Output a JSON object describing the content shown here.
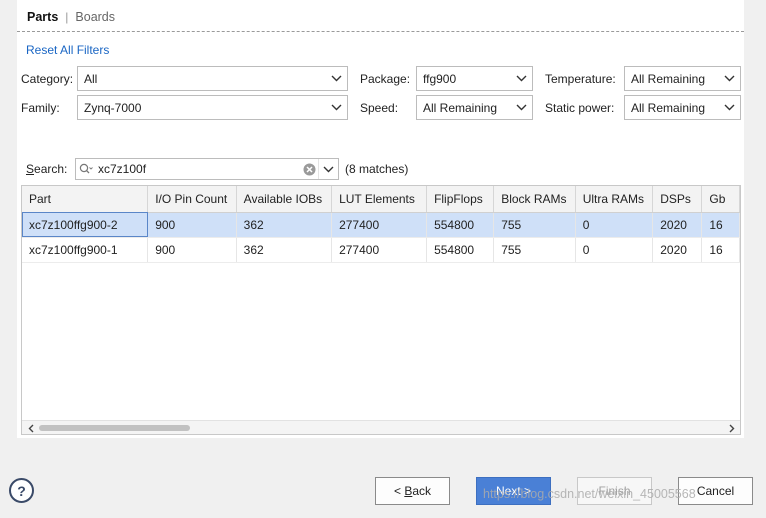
{
  "tabs": [
    {
      "label": "Parts"
    },
    {
      "label": "Boards"
    }
  ],
  "reset_filters": "Reset All Filters",
  "filters": {
    "category": {
      "label": "Category:",
      "value": "All"
    },
    "family": {
      "label": "Family:",
      "value": "Zynq-7000"
    },
    "package": {
      "label": "Package:",
      "value": "ffg900"
    },
    "speed": {
      "label": "Speed:",
      "value": "All Remaining"
    },
    "temperature": {
      "label": "Temperature:",
      "value": "All Remaining"
    },
    "static_power": {
      "label": "Static power:",
      "value": "All Remaining"
    }
  },
  "search": {
    "label_prefix": "S",
    "label_rest": "earch:",
    "value": "xc7z100f",
    "matches": "(8 matches)"
  },
  "table": {
    "columns": [
      "Part",
      "I/O Pin Count",
      "Available IOBs",
      "LUT Elements",
      "FlipFlops",
      "Block RAMs",
      "Ultra RAMs",
      "DSPs",
      "Gb"
    ],
    "rows": [
      [
        "xc7z100ffg900-2",
        "900",
        "362",
        "277400",
        "554800",
        "755",
        "0",
        "2020",
        "16"
      ],
      [
        "xc7z100ffg900-1",
        "900",
        "362",
        "277400",
        "554800",
        "755",
        "0",
        "2020",
        "16"
      ]
    ],
    "selected_row": 0
  },
  "buttons": {
    "help": "?",
    "back_prefix": "< ",
    "back_ul": "B",
    "back_rest": "ack",
    "next": "Next >",
    "finish": "Finish",
    "cancel": "Cancel"
  },
  "watermark": "https://blog.csdn.net/weixin_45005568",
  "colors": {
    "link": "#1a66c4",
    "selection": "#cfe0f8",
    "primary_button": "#4a80d6"
  }
}
